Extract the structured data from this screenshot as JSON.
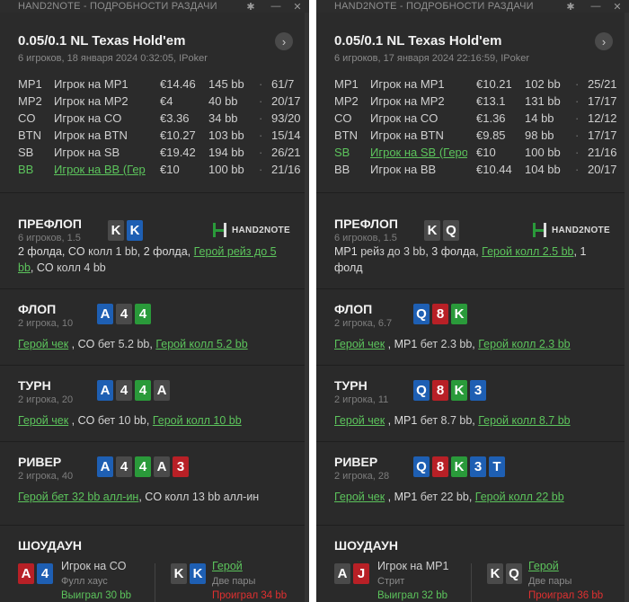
{
  "hands": [
    {
      "window_title": "HAND2NOTE - ПОДРОБНОСТИ РАЗДАЧИ",
      "game": "0.05/0.1 NL Texas Hold'em",
      "subtitle": "6 игроков, 18 января 2024 0:32:05, IPoker",
      "players": [
        {
          "seat": "MP1",
          "name": "Игрок на MP1",
          "stack": "€14.46",
          "bb": "145 bb",
          "dot": "·",
          "hands": "61/7",
          "hero": false
        },
        {
          "seat": "MP2",
          "name": "Игрок на MP2",
          "stack": "€4",
          "bb": "40 bb",
          "dot": "·",
          "hands": "20/17",
          "hero": false
        },
        {
          "seat": "CO",
          "name": "Игрок на CO",
          "stack": "€3.36",
          "bb": "34 bb",
          "dot": "·",
          "hands": "93/20",
          "hero": false
        },
        {
          "seat": "BTN",
          "name": "Игрок на BTN",
          "stack": "€10.27",
          "bb": "103 bb",
          "dot": "·",
          "hands": "15/14",
          "hero": false
        },
        {
          "seat": "SB",
          "name": "Игрок на SB",
          "stack": "€19.42",
          "bb": "194 bb",
          "dot": "·",
          "hands": "26/21",
          "hero": false
        },
        {
          "seat": "BB",
          "name": "Игрок на BB (Гер",
          "stack": "€10",
          "bb": "100 bb",
          "dot": "·",
          "hands": "21/16",
          "hero": true
        }
      ],
      "preflop": {
        "title": "ПРЕФЛОП",
        "sub": "6 игроков, 1.5",
        "cards": [
          {
            "r": "K",
            "s": "s"
          },
          {
            "r": "K",
            "s": "d"
          }
        ],
        "action": [
          {
            "t": "2 фолда, CO ",
            "h": false
          },
          {
            "t": "колл 1 bb",
            "h": false,
            "w": true
          },
          {
            "t": ", 2 фолда, ",
            "h": false
          },
          {
            "t": "Герой рейз до 5 bb",
            "h": true
          },
          {
            "t": ", CO ",
            "h": false
          },
          {
            "t": "колл 4 bb",
            "h": false,
            "w": true
          }
        ]
      },
      "flop": {
        "title": "ФЛОП",
        "sub": "2 игрока, 10",
        "cards": [
          {
            "r": "A",
            "s": "d"
          },
          {
            "r": "4",
            "s": "s"
          },
          {
            "r": "4",
            "s": "c"
          }
        ],
        "action": [
          {
            "t": "Герой чек",
            "h": true
          },
          {
            "t": " , CO ",
            "h": false
          },
          {
            "t": "бет 5.2 bb",
            "h": false,
            "w": true
          },
          {
            "t": ", ",
            "h": false
          },
          {
            "t": "Герой колл 5.2 bb",
            "h": true
          }
        ]
      },
      "turn": {
        "title": "ТУРН",
        "sub": "2 игрока, 20",
        "cards": [
          {
            "r": "A",
            "s": "d"
          },
          {
            "r": "4",
            "s": "s"
          },
          {
            "r": "4",
            "s": "c"
          },
          {
            "r": "A",
            "s": "s"
          }
        ],
        "action": [
          {
            "t": "Герой чек",
            "h": true
          },
          {
            "t": " , CO ",
            "h": false
          },
          {
            "t": "бет 10 bb",
            "h": false,
            "w": true
          },
          {
            "t": ", ",
            "h": false
          },
          {
            "t": "Герой колл 10 bb",
            "h": true
          }
        ]
      },
      "river": {
        "title": "РИВЕР",
        "sub": "2 игрока, 40",
        "cards": [
          {
            "r": "A",
            "s": "d"
          },
          {
            "r": "4",
            "s": "s"
          },
          {
            "r": "4",
            "s": "c"
          },
          {
            "r": "A",
            "s": "s"
          },
          {
            "r": "3",
            "s": "h"
          }
        ],
        "action": [
          {
            "t": "Герой бет 32 bb алл-ин",
            "h": true
          },
          {
            "t": ", CO ",
            "h": false
          },
          {
            "t": "колл 13 bb алл-ин",
            "h": false,
            "w": true
          }
        ]
      },
      "showdown": {
        "title": "ШОУДАУН",
        "left": {
          "cards": [
            {
              "r": "A",
              "s": "h"
            },
            {
              "r": "4",
              "s": "d"
            }
          ],
          "name": "Игрок на CO",
          "hand": "Фулл хаус",
          "result": "Выиграл 30 bb",
          "win": true,
          "hero": false
        },
        "right": {
          "cards": [
            {
              "r": "K",
              "s": "s"
            },
            {
              "r": "K",
              "s": "d"
            }
          ],
          "name": "Герой",
          "hand": "Две пары",
          "result": "Проиграл 34 bb",
          "win": false,
          "hero": true
        }
      }
    },
    {
      "window_title": "HAND2NOTE - ПОДРОБНОСТИ РАЗДАЧИ",
      "game": "0.05/0.1 NL Texas Hold'em",
      "subtitle": "6 игроков, 17 января 2024 22:16:59, IPoker",
      "players": [
        {
          "seat": "MP1",
          "name": "Игрок на MP1",
          "stack": "€10.21",
          "bb": "102 bb",
          "dot": "·",
          "hands": "25/21",
          "hero": false
        },
        {
          "seat": "MP2",
          "name": "Игрок на MP2",
          "stack": "€13.1",
          "bb": "131 bb",
          "dot": "·",
          "hands": "17/17",
          "hero": false
        },
        {
          "seat": "CO",
          "name": "Игрок на CO",
          "stack": "€1.36",
          "bb": "14 bb",
          "dot": "·",
          "hands": "12/12",
          "hero": false
        },
        {
          "seat": "BTN",
          "name": "Игрок на BTN",
          "stack": "€9.85",
          "bb": "98 bb",
          "dot": "·",
          "hands": "17/17",
          "hero": false
        },
        {
          "seat": "SB",
          "name": "Игрок на SB (Геро",
          "stack": "€10",
          "bb": "100 bb",
          "dot": "·",
          "hands": "21/16",
          "hero": true
        },
        {
          "seat": "BB",
          "name": "Игрок на BB",
          "stack": "€10.44",
          "bb": "104 bb",
          "dot": "·",
          "hands": "20/17",
          "hero": false
        }
      ],
      "preflop": {
        "title": "ПРЕФЛОП",
        "sub": "6 игроков, 1.5",
        "cards": [
          {
            "r": "K",
            "s": "s"
          },
          {
            "r": "Q",
            "s": "s"
          }
        ],
        "action": [
          {
            "t": "MP1 ",
            "h": false
          },
          {
            "t": "рейз до 3 bb",
            "h": false,
            "w": true
          },
          {
            "t": ", 3 фолда, ",
            "h": false
          },
          {
            "t": "Герой колл 2.5 bb",
            "h": true
          },
          {
            "t": ", 1 фолд",
            "h": false
          }
        ]
      },
      "flop": {
        "title": "ФЛОП",
        "sub": "2 игрока, 6.7",
        "cards": [
          {
            "r": "Q",
            "s": "d"
          },
          {
            "r": "8",
            "s": "h"
          },
          {
            "r": "K",
            "s": "c"
          }
        ],
        "action": [
          {
            "t": "Герой чек",
            "h": true
          },
          {
            "t": " , MP1 ",
            "h": false
          },
          {
            "t": "бет 2.3 bb",
            "h": false,
            "w": true
          },
          {
            "t": ", ",
            "h": false
          },
          {
            "t": "Герой колл 2.3 bb",
            "h": true
          }
        ]
      },
      "turn": {
        "title": "ТУРН",
        "sub": "2 игрока, 11",
        "cards": [
          {
            "r": "Q",
            "s": "d"
          },
          {
            "r": "8",
            "s": "h"
          },
          {
            "r": "K",
            "s": "c"
          },
          {
            "r": "3",
            "s": "d"
          }
        ],
        "action": [
          {
            "t": "Герой чек",
            "h": true
          },
          {
            "t": " , MP1 ",
            "h": false
          },
          {
            "t": "бет 8.7 bb",
            "h": false,
            "w": true
          },
          {
            "t": ", ",
            "h": false
          },
          {
            "t": "Герой колл 8.7 bb",
            "h": true
          }
        ]
      },
      "river": {
        "title": "РИВЕР",
        "sub": "2 игрока, 28",
        "cards": [
          {
            "r": "Q",
            "s": "d"
          },
          {
            "r": "8",
            "s": "h"
          },
          {
            "r": "K",
            "s": "c"
          },
          {
            "r": "3",
            "s": "d"
          },
          {
            "r": "T",
            "s": "d"
          }
        ],
        "action": [
          {
            "t": "Герой чек",
            "h": true
          },
          {
            "t": " , MP1 ",
            "h": false
          },
          {
            "t": "бет 22 bb",
            "h": false,
            "w": true
          },
          {
            "t": ", ",
            "h": false
          },
          {
            "t": "Герой колл 22 bb",
            "h": true
          }
        ]
      },
      "showdown": {
        "title": "ШОУДАУН",
        "left": {
          "cards": [
            {
              "r": "A",
              "s": "s"
            },
            {
              "r": "J",
              "s": "h"
            }
          ],
          "name": "Игрок на MP1",
          "hand": "Стрит",
          "result": "Выиграл 32 bb",
          "win": true,
          "hero": false
        },
        "right": {
          "cards": [
            {
              "r": "K",
              "s": "s"
            },
            {
              "r": "Q",
              "s": "s"
            }
          ],
          "name": "Герой",
          "hand": "Две пары",
          "result": "Проиграл 36 bb",
          "win": false,
          "hero": true
        }
      }
    }
  ],
  "icons": {
    "gear": "gear-icon",
    "minimize": "minimize-icon",
    "close": "close-icon",
    "next": "chevron-right-icon",
    "logo": "hand2note-logo-icon"
  },
  "logo_text": "HAND2NOTE",
  "controls": {
    "gear": "✱",
    "minimize": "—",
    "close": "✕",
    "next": "›"
  },
  "colors": {
    "hero": "#5cc45c",
    "loss": "#e03030",
    "spade": "#4a4a4a",
    "diamond": "#1e5fb3",
    "club": "#2a9a3a",
    "heart": "#b82026"
  }
}
